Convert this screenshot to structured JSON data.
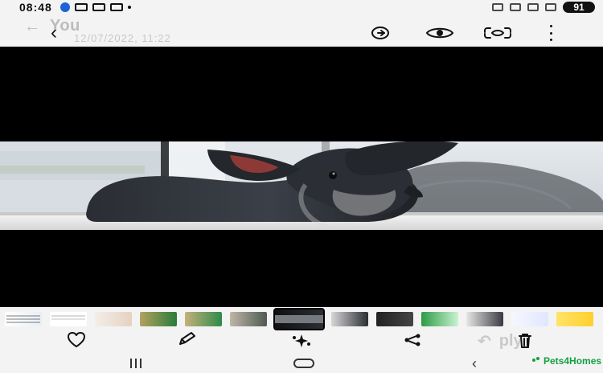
{
  "status_bar": {
    "time": "08:48",
    "battery": "91"
  },
  "top_toolbar": {
    "ghost_title": "You",
    "ghost_subtitle": "12/07/2022, 11:22"
  },
  "watermark": {
    "badge_name": "watermark-badge"
  },
  "filmstrip": {
    "selected_index": 6,
    "thumbs": [
      {
        "name": "thumbnail-1"
      },
      {
        "name": "thumbnail-2"
      },
      {
        "name": "thumbnail-3"
      },
      {
        "name": "thumbnail-4"
      },
      {
        "name": "thumbnail-5"
      },
      {
        "name": "thumbnail-6"
      },
      {
        "name": "thumbnail-7"
      },
      {
        "name": "thumbnail-8"
      },
      {
        "name": "thumbnail-9"
      },
      {
        "name": "thumbnail-10"
      },
      {
        "name": "thumbnail-11"
      },
      {
        "name": "thumbnail-12"
      },
      {
        "name": "thumbnail-13"
      }
    ]
  },
  "actions": {
    "ghost_reply": "ply"
  },
  "logo": {
    "text": "Pets4Homes"
  },
  "colors": {
    "viewer_bg": "#000000",
    "page_bg": "#f3f3f3",
    "icon": "#111111",
    "watermark": "#d7b14d",
    "brand_green": "#12a043"
  }
}
